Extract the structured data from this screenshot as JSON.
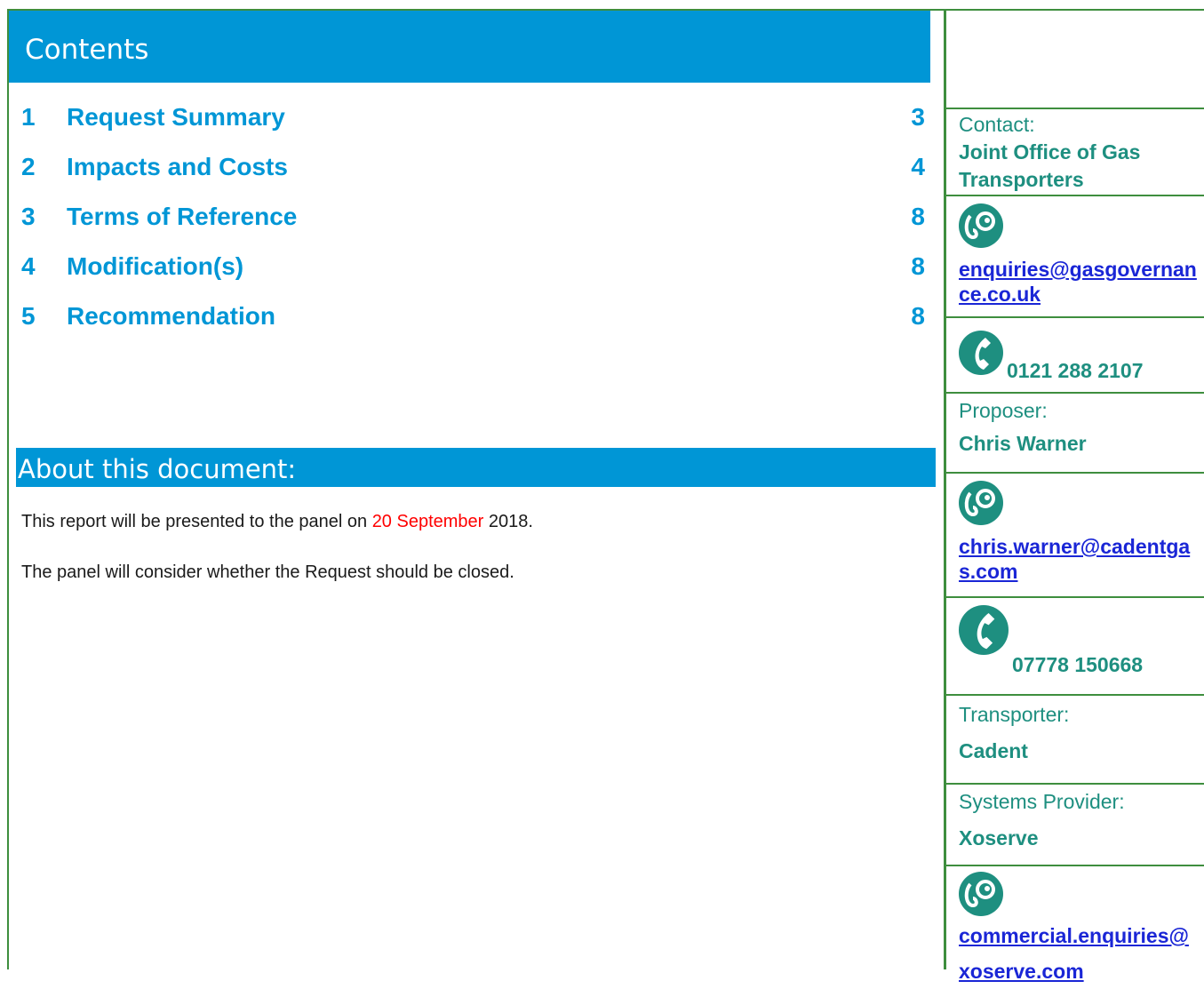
{
  "contents": {
    "heading": "Contents",
    "items": [
      {
        "num": "1",
        "title": "Request Summary",
        "page": "3"
      },
      {
        "num": "2",
        "title": "Impacts and Costs",
        "page": "4"
      },
      {
        "num": "3",
        "title": "Terms of Reference",
        "page": "8"
      },
      {
        "num": "4",
        "title": "Modification(s)",
        "page": "8"
      },
      {
        "num": "5",
        "title": "Recommendation",
        "page": "8"
      }
    ]
  },
  "about": {
    "heading": "About this document:",
    "line1_pre": "This report will be presented to the panel on ",
    "line1_date": "20 September",
    "line1_post": " 2018.",
    "line2": "The panel will consider whether the Request should be closed."
  },
  "sidebar": {
    "contact_label": "Contact:",
    "contact_name": "Joint Office of Gas Transporters",
    "contact_email": "enquiries@gasgovernance.co.uk",
    "contact_phone": "0121 288 2107",
    "proposer_label": "Proposer:",
    "proposer_name": "Chris Warner",
    "proposer_email": "chris.warner@cadentgas.com",
    "proposer_phone": "07778 150668",
    "transporter_label": "Transporter:",
    "transporter_name": "Cadent",
    "systems_label": "Systems Provider:",
    "systems_name": "Xoserve",
    "systems_email": "commercial.enquiries@xoserve.com"
  },
  "colors": {
    "accent_blue": "#0096d6",
    "teal": "#1e8f80",
    "border_green": "#3e8e3e",
    "link": "#1a26d6",
    "highlight": "#ff0000"
  },
  "icons": [
    "email-icon",
    "phone-icon"
  ]
}
